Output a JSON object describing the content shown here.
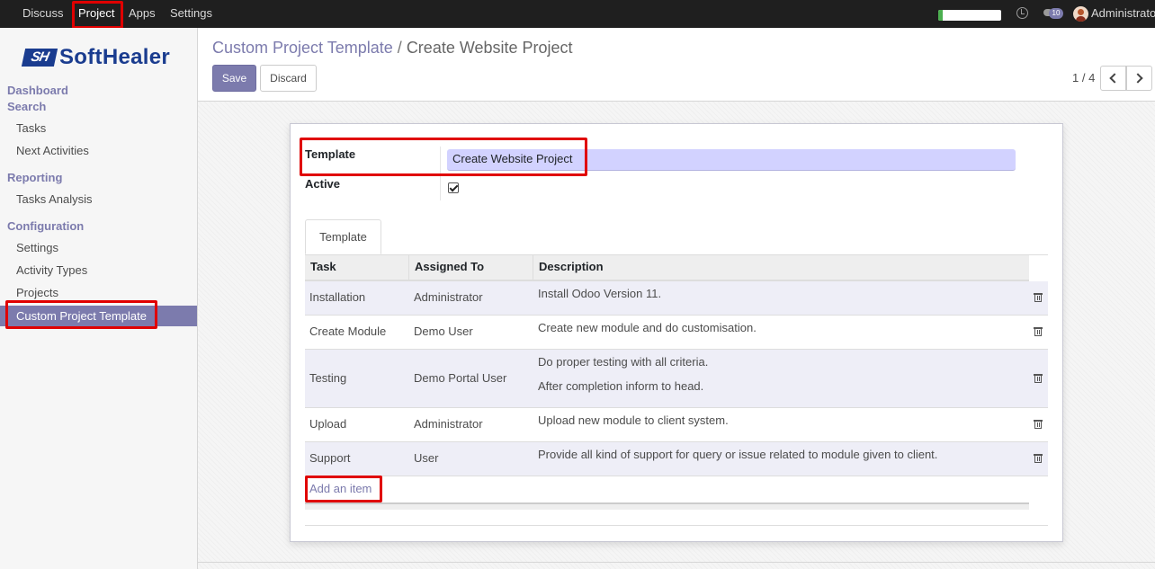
{
  "topbar": {
    "menu": [
      "Discuss",
      "Project",
      "Apps",
      "Settings"
    ],
    "active_menu": "Project",
    "notification_count": "10",
    "user_name": "Administrator",
    "progress_fraction": 0.07
  },
  "sidebar": {
    "logo_mark": "SH",
    "logo_text": "SoftHealer",
    "sections": [
      {
        "title": "Dashboard"
      },
      {
        "title": "Search",
        "items": [
          "Tasks",
          "Next Activities"
        ]
      },
      {
        "title": "Reporting",
        "items": [
          "Tasks Analysis"
        ]
      },
      {
        "title": "Configuration",
        "items": [
          "Settings",
          "Activity Types",
          "Projects",
          "Custom Project Template"
        ]
      }
    ],
    "active_item": "Custom Project Template"
  },
  "control_panel": {
    "breadcrumb_parent": "Custom Project Template",
    "breadcrumb_separator": "/",
    "breadcrumb_current": "Create Website Project",
    "save_label": "Save",
    "discard_label": "Discard",
    "pager": "1 / 4"
  },
  "form": {
    "template_label": "Template",
    "template_value": "Create Website Project",
    "active_label": "Active",
    "active_checked": true,
    "tab_label": "Template",
    "table": {
      "columns": [
        "Task",
        "Assigned To",
        "Description"
      ],
      "rows": [
        {
          "task": "Installation",
          "assigned": "Administrator",
          "description": [
            "Install Odoo Version 11."
          ]
        },
        {
          "task": "Create Module",
          "assigned": "Demo User",
          "description": [
            "Create new module and do customisation."
          ]
        },
        {
          "task": "Testing",
          "assigned": "Demo Portal User",
          "description": [
            "Do proper testing with all criteria.",
            "After completion inform to head."
          ]
        },
        {
          "task": "Upload",
          "assigned": "Administrator",
          "description": [
            "Upload new module to client system."
          ]
        },
        {
          "task": "Support",
          "assigned": "User",
          "description": [
            "Provide all kind of support for query or issue related to module given to client."
          ]
        }
      ],
      "add_item_label": "Add an item"
    }
  },
  "colors": {
    "brand": "#7c7bad",
    "highlight": "#e00000",
    "navbar": "#1f1f1f",
    "logo": "#1a3c8f"
  }
}
